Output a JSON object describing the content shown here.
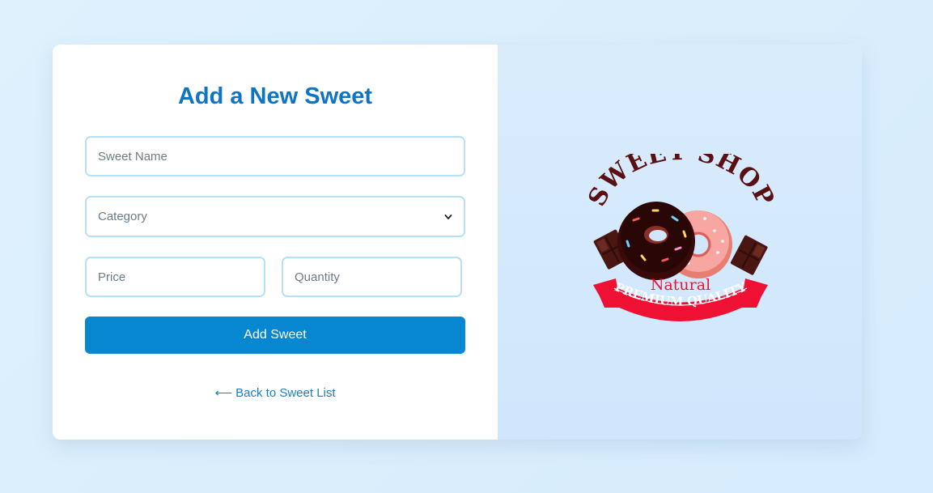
{
  "form": {
    "title": "Add a New Sweet",
    "name_placeholder": "Sweet Name",
    "category_placeholder": "Category",
    "price_placeholder": "Price",
    "quantity_placeholder": "Quantity",
    "submit_label": "Add Sweet",
    "back_link": "⟵ Back to Sweet List"
  },
  "logo": {
    "arc_text": "SWEET SHOP",
    "subtitle": "Natural",
    "ribbon_text": "PREMIUM QUALITY"
  },
  "colors": {
    "accent": "#0887d1",
    "title": "#0f75c3",
    "field_border": "#b6e0f5",
    "logo_ribbon": "#ee1133",
    "logo_dark": "#5a0f12"
  }
}
